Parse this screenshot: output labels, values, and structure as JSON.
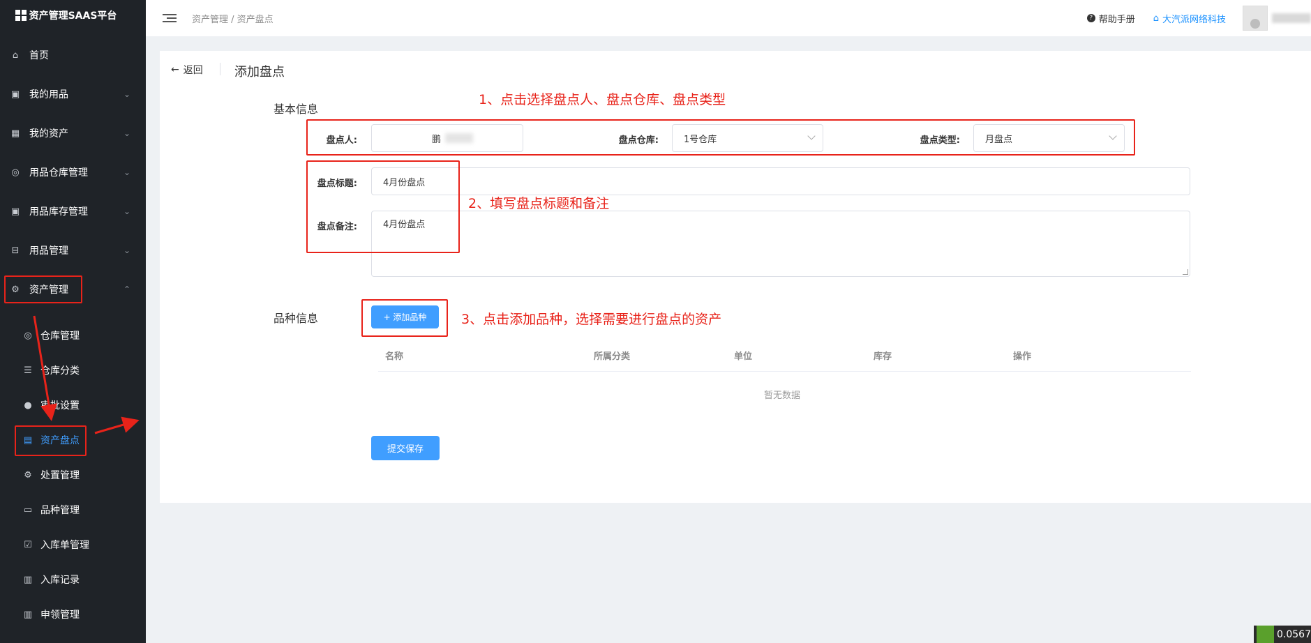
{
  "app": {
    "title": "资产管理SAAS平台"
  },
  "sidebar": {
    "items": [
      {
        "label": "首页",
        "icon": "home-icon"
      },
      {
        "label": "我的用品",
        "icon": "box-icon"
      },
      {
        "label": "我的资产",
        "icon": "building-icon"
      },
      {
        "label": "用品仓库管理",
        "icon": "database-icon"
      },
      {
        "label": "用品库存管理",
        "icon": "box-icon"
      },
      {
        "label": "用品管理",
        "icon": "tray-icon"
      },
      {
        "label": "资产管理",
        "icon": "cog-box-icon"
      }
    ],
    "subitems": [
      {
        "label": "仓库管理",
        "icon": "database-icon"
      },
      {
        "label": "仓库分类",
        "icon": "sliders-icon"
      },
      {
        "label": "审批设置",
        "icon": "user-icon"
      },
      {
        "label": "资产盘点",
        "icon": "document-icon"
      },
      {
        "label": "处置管理",
        "icon": "gear-icon"
      },
      {
        "label": "品种管理",
        "icon": "lock-icon"
      },
      {
        "label": "入库单管理",
        "icon": "clipboard-check-icon"
      },
      {
        "label": "入库记录",
        "icon": "clipboard-icon"
      },
      {
        "label": "申领管理",
        "icon": "clipboard-icon"
      }
    ]
  },
  "header": {
    "breadcrumb": "资产管理 / 资产盘点",
    "help": "帮助手册",
    "company": "大汽派网络科技"
  },
  "page": {
    "back": "返回",
    "title": "添加盘点"
  },
  "form": {
    "section_basic": "基本信息",
    "person_label": "盘点人:",
    "person_value": "鹏",
    "warehouse_label": "盘点仓库:",
    "warehouse_value": "1号仓库",
    "type_label": "盘点类型:",
    "type_value": "月盘点",
    "title_label": "盘点标题:",
    "title_value": "4月份盘点",
    "remark_label": "盘点备注:",
    "remark_value": "4月份盘点",
    "section_variety": "品种信息",
    "add_button": "+ 添加品种",
    "table_headers": [
      "名称",
      "所属分类",
      "单位",
      "库存",
      "操作"
    ],
    "empty_text": "暂无数据",
    "submit_button": "提交保存"
  },
  "annotations": {
    "step1": "1、点击选择盘点人、盘点仓库、盘点类型",
    "step2": "2、填写盘点标题和备注",
    "step3": "3、点击添加品种，选择需要进行盘点的资产"
  },
  "widget": {
    "value": "0.0567"
  },
  "colors": {
    "sidebar_bg": "#1f2328",
    "primary": "#409eff",
    "annotation": "#e8231a"
  }
}
